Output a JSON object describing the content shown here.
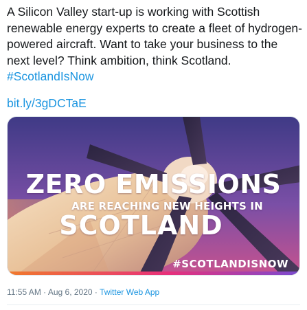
{
  "tweet": {
    "text_lines": [
      "A Silicon Valley start-up is working with Scottish",
      "renewable energy experts to create a fleet of hydrogen-",
      "powered aircraft. Want to take your business to the",
      "next level? Think ambition, think Scotland."
    ],
    "hashtag": "#ScotlandIsNow",
    "link": "bit.ly/3gDCTaE"
  },
  "media": {
    "headline_line1": "ZERO EMISSIONS",
    "headline_line2": "ARE REACHING NEW HEIGHTS IN",
    "headline_line3": "SCOTLAND",
    "campaign_hashtag": "#SCOTLANDISNOW",
    "colors": {
      "sky_top": "#4a3f8c",
      "sky_bottom": "#d9508a",
      "accent_orange": "#f07a2c"
    }
  },
  "meta": {
    "time": "11:55 AM",
    "separator": "·",
    "date": "Aug 6, 2020",
    "source": "Twitter Web App"
  },
  "colors": {
    "link": "#1b95e0",
    "text": "#14171a",
    "meta": "#657786"
  }
}
